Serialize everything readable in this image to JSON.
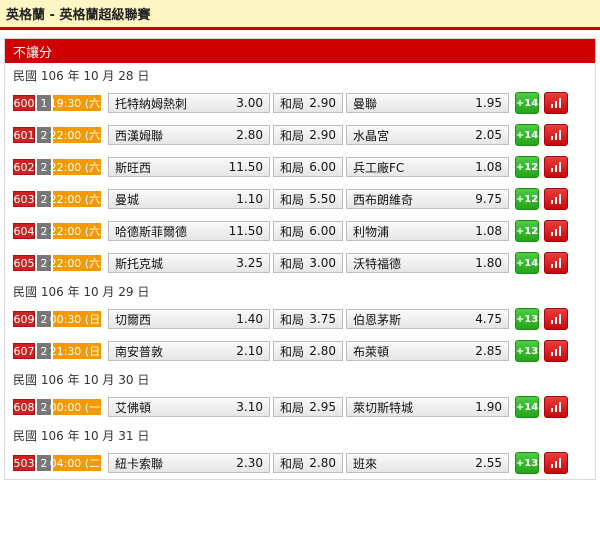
{
  "header": {
    "title": "英格蘭 - 英格蘭超級聯賽"
  },
  "section": {
    "title": "不讓分"
  },
  "colors": {
    "accent_red": "#d00000",
    "time_orange": "#f39a00",
    "more_green": "#2aa521",
    "header_bg": "#fdf6c2"
  },
  "groups": [
    {
      "date": "民國 106 年 10 月 28 日",
      "matches": [
        {
          "no": "600",
          "flag": "1",
          "time": "19:30 (六)",
          "home": "托特納姆熱刺",
          "home_odds": "3.00",
          "draw_label": "和局",
          "draw_odds": "2.90",
          "away": "曼聯",
          "away_odds": "1.95",
          "more": "+14"
        },
        {
          "no": "601",
          "flag": "2",
          "time": "22:00 (六)",
          "home": "西漢姆聯",
          "home_odds": "2.80",
          "draw_label": "和局",
          "draw_odds": "2.90",
          "away": "水晶宮",
          "away_odds": "2.05",
          "more": "+14"
        },
        {
          "no": "602",
          "flag": "2",
          "time": "22:00 (六)",
          "home": "斯旺西",
          "home_odds": "11.50",
          "draw_label": "和局",
          "draw_odds": "6.00",
          "away": "兵工廠FC",
          "away_odds": "1.08",
          "more": "+12"
        },
        {
          "no": "603",
          "flag": "2",
          "time": "22:00 (六)",
          "home": "曼城",
          "home_odds": "1.10",
          "draw_label": "和局",
          "draw_odds": "5.50",
          "away": "西布朗維奇",
          "away_odds": "9.75",
          "more": "+12"
        },
        {
          "no": "604",
          "flag": "2",
          "time": "22:00 (六)",
          "home": "哈德斯菲爾德",
          "home_odds": "11.50",
          "draw_label": "和局",
          "draw_odds": "6.00",
          "away": "利物浦",
          "away_odds": "1.08",
          "more": "+12"
        },
        {
          "no": "605",
          "flag": "2",
          "time": "22:00 (六)",
          "home": "斯托克城",
          "home_odds": "3.25",
          "draw_label": "和局",
          "draw_odds": "3.00",
          "away": "沃特福德",
          "away_odds": "1.80",
          "more": "+14"
        }
      ]
    },
    {
      "date": "民國 106 年 10 月 29 日",
      "matches": [
        {
          "no": "609",
          "flag": "2",
          "time": "00:30 (日)",
          "home": "切爾西",
          "home_odds": "1.40",
          "draw_label": "和局",
          "draw_odds": "3.75",
          "away": "伯恩茅斯",
          "away_odds": "4.75",
          "more": "+13"
        },
        {
          "no": "607",
          "flag": "2",
          "time": "21:30 (日)",
          "home": "南安普敦",
          "home_odds": "2.10",
          "draw_label": "和局",
          "draw_odds": "2.80",
          "away": "布萊頓",
          "away_odds": "2.85",
          "more": "+13"
        }
      ]
    },
    {
      "date": "民國 106 年 10 月 30 日",
      "matches": [
        {
          "no": "608",
          "flag": "2",
          "time": "00:00 (一)",
          "home": "艾佛頓",
          "home_odds": "3.10",
          "draw_label": "和局",
          "draw_odds": "2.95",
          "away": "萊切斯特城",
          "away_odds": "1.90",
          "more": "+14"
        }
      ]
    },
    {
      "date": "民國 106 年 10 月 31 日",
      "matches": [
        {
          "no": "503",
          "flag": "2",
          "time": "04:00 (二)",
          "home": "紐卡索聯",
          "home_odds": "2.30",
          "draw_label": "和局",
          "draw_odds": "2.80",
          "away": "班來",
          "away_odds": "2.55",
          "more": "+13"
        }
      ]
    }
  ]
}
